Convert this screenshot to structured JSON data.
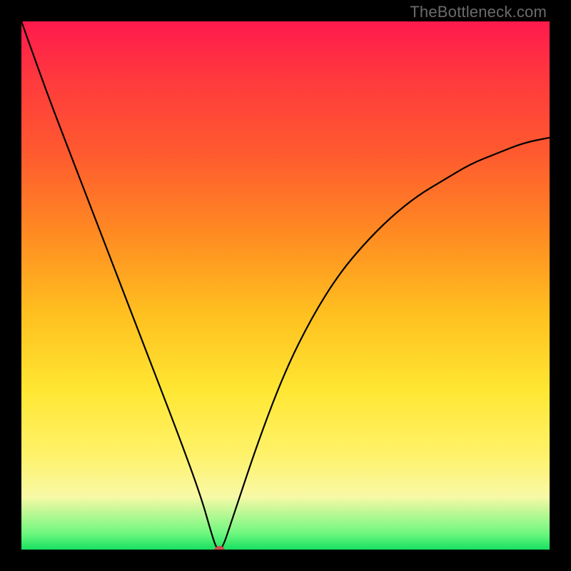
{
  "watermark": {
    "text": "TheBottleneck.com"
  },
  "chart_data": {
    "type": "line",
    "title": "",
    "xlabel": "",
    "ylabel": "",
    "xlim": [
      0,
      100
    ],
    "ylim": [
      0,
      100
    ],
    "grid": false,
    "series": [
      {
        "name": "curve",
        "x": [
          0,
          5,
          10,
          15,
          20,
          25,
          30,
          34,
          36,
          37,
          38,
          40,
          45,
          50,
          55,
          60,
          65,
          70,
          75,
          80,
          85,
          90,
          95,
          100
        ],
        "values": [
          100,
          86,
          73,
          60,
          47,
          34,
          21,
          10,
          3,
          0,
          0,
          6,
          21,
          34,
          44,
          52,
          58,
          63,
          67,
          70,
          73,
          75,
          77,
          78
        ]
      }
    ],
    "marker": {
      "x": 37.5,
      "y": 0,
      "color": "#d24a4a"
    },
    "gradient_stops": [
      {
        "pos": 0,
        "color": "#ff1a4d"
      },
      {
        "pos": 12,
        "color": "#ff3c3c"
      },
      {
        "pos": 25,
        "color": "#ff5a2f"
      },
      {
        "pos": 40,
        "color": "#ff8a22"
      },
      {
        "pos": 55,
        "color": "#ffbf1f"
      },
      {
        "pos": 70,
        "color": "#ffe733"
      },
      {
        "pos": 82,
        "color": "#fff26a"
      },
      {
        "pos": 90,
        "color": "#f8f9a6"
      },
      {
        "pos": 97,
        "color": "#6df77f"
      },
      {
        "pos": 100,
        "color": "#17e060"
      }
    ]
  }
}
